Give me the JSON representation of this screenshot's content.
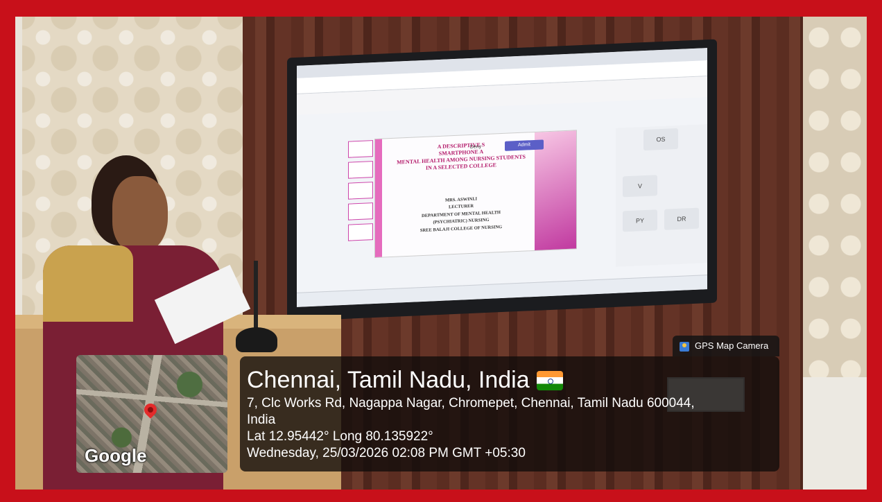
{
  "gps": {
    "badge": "GPS Map Camera",
    "title": "Chennai, Tamil Nadu, India",
    "address_line1": "7, Clc Works Rd, Nagappa Nagar, Chromepet, Chennai, Tamil Nadu 600044,",
    "address_line2": "India",
    "coords": "Lat 12.95442° Long 80.135922°",
    "datetime": "Wednesday, 25/03/2026 02:08 PM GMT +05:30",
    "map_label": "Google"
  },
  "screen": {
    "slide_title": "A DESCRIPTIVE S\nSMARTPHONE A\nMENTAL HEALTH AMONG NURSING STUDENTS\nIN A SELECTED COLLEGE",
    "slide_presenter": "MRS. ASWINI.I\nLECTURER\nDEPARTMENT OF MENTAL HEALTH\n(PSYCHIATRIC) NURSING\nSREE BALAJI COLLEGE OF NURSING",
    "admit_label": "Admit",
    "deny_label": "Deny",
    "participants": [
      "OS",
      "V",
      "PY",
      "DR"
    ]
  },
  "colors": {
    "frame": "#c8101a",
    "accent": "#5b5fc7"
  }
}
